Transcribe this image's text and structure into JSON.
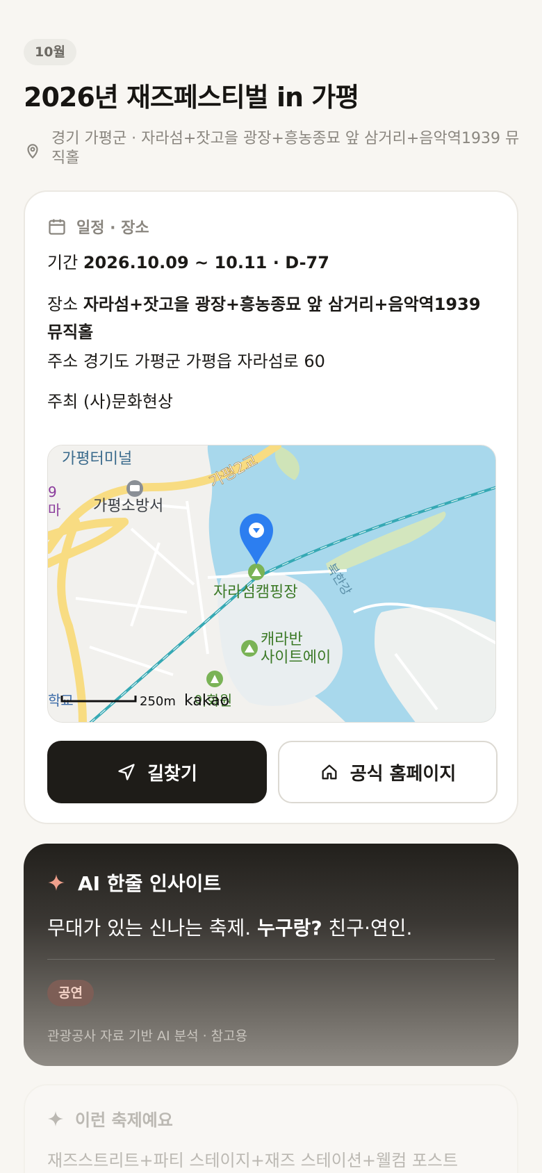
{
  "header": {
    "month_badge": "10월",
    "title": "2026년 재즈페스티벌 in 가평",
    "location": "경기 가평군 · 자라섬+잣고을 광장+흥농종묘 앞 삼거리+음악역1939 뮤직홀"
  },
  "info_card": {
    "section_title": "일정 · 장소",
    "period_label": "기간",
    "period_value": "2026.10.09 ~ 10.11 · D-77",
    "venue_label": "장소",
    "venue_value": "자라섬+잣고을 광장+흥농종묘 앞 삼거리+음악역1939 뮤직홀",
    "address_label": "주소",
    "address_value": "경기도 가평군 가평읍 자라섬로 60",
    "host_label": "주최",
    "host_value": "(사)문화현상",
    "map": {
      "labels": {
        "terminal": "가평터미널",
        "fire_station": "가평소방서",
        "bridge": "가평2교",
        "river": "북한강",
        "camping": "자라섬캠핑장",
        "caravan_1": "캐라반",
        "caravan_2": "사이트에이",
        "park": "이화원",
        "school": "학교",
        "edge_a": "9",
        "edge_b": "마",
        "scale": "250m",
        "brand": "kakao"
      },
      "colors": {
        "water": "#a8d8ec",
        "road_major": "#f8dc82",
        "rail": "#36a9b4",
        "marker": "#2c7ef0",
        "park": "#7ab356"
      }
    },
    "buttons": {
      "directions": "길찾기",
      "homepage": "공식 홈페이지"
    }
  },
  "ai_insight": {
    "title": "AI 한줄 인사이트",
    "line_plain": "무대가 있는 신나는 축제.",
    "line_bold": "누구랑?",
    "line_tail": "친구·연인.",
    "tag": "공연",
    "note": "관광공사 자료 기반 AI 분석 · 참고용"
  },
  "suggest": {
    "title": "이런 축제예요",
    "text": "재즈스트리트+파티 스테이지+재즈 스테이션+웰컴 포스트"
  }
}
